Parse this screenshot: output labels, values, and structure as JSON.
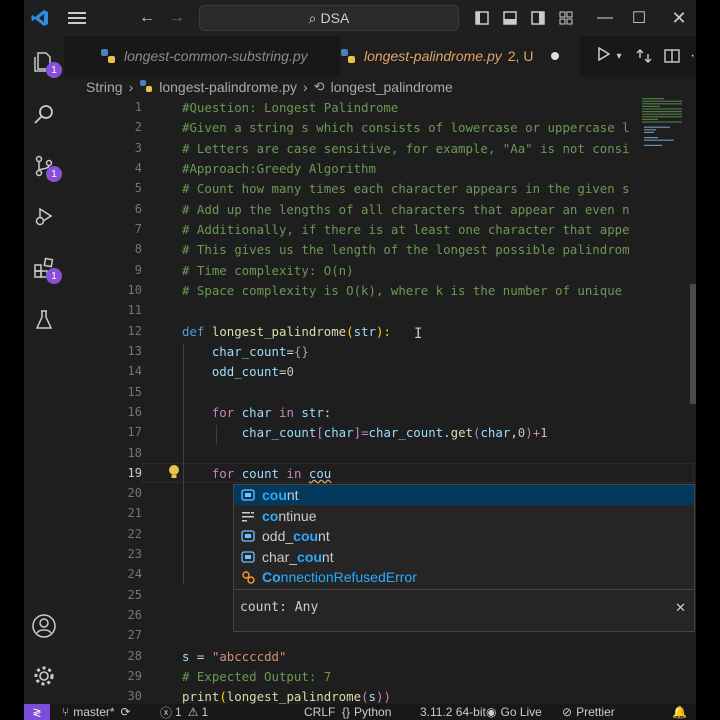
{
  "titlebar": {
    "search_text": "DSA"
  },
  "activity": {
    "explorer_badge": "1",
    "scm_badge": "1",
    "extensions_badge": "1"
  },
  "tabs": [
    {
      "label": "longest-common-substring.py"
    },
    {
      "label": "longest-palindrome.py",
      "status": "2, U"
    }
  ],
  "breadcrumb": {
    "folder": "String",
    "file": "longest-palindrome.py",
    "symbol": "longest_palindrome"
  },
  "editor": {
    "line_numbers": [
      "1",
      "2",
      "3",
      "4",
      "5",
      "6",
      "7",
      "8",
      "9",
      "10",
      "11",
      "12",
      "13",
      "14",
      "15",
      "16",
      "17",
      "18",
      "19",
      "20",
      "21",
      "22",
      "23",
      "24",
      "25",
      "26",
      "27",
      "28",
      "29",
      "30"
    ],
    "comments": [
      "#Question: Longest Palindrome",
      "#Given a string s which consists of lowercase or uppercase l",
      "# Letters are case sensitive, for example, \"Aa\" is not consi",
      "#Approach:Greedy Algorithm",
      "# Count how many times each character appears in the given s",
      "# Add up the lengths of all characters that appear an even n",
      "# Additionally, if there is at least one character that appe",
      "# This gives us the length of the longest possible palindrom",
      "# Time complexity: O(n)",
      "# Space complexity is O(k), where k is the number of unique "
    ],
    "l12": {
      "def": "def",
      "name": "longest_palindrome",
      "open": "(",
      "param": "str",
      "close": "):"
    },
    "l13": {
      "var": "char_count",
      "eq": "=",
      "val": "{}"
    },
    "l14": {
      "var": "odd_count",
      "eq": "=",
      "val": "0"
    },
    "l16": {
      "for": "for",
      "var": "char",
      "in": "in",
      "iter": "str",
      "colon": ":"
    },
    "l17": {
      "a": "char_count",
      "b": "[",
      "c": "char",
      "d": "]=",
      "e": "char_count",
      "f": ".",
      "g": "get",
      "h": "(",
      "i": "char",
      "j": ",",
      "k": "0",
      "l": ")+",
      "m": "1"
    },
    "l19": {
      "for": "for",
      "var": "count",
      "in": "in",
      "typed": "cou"
    },
    "l28": {
      "var": "s",
      "eq": " = ",
      "val": "\"abccccdd\""
    },
    "l29": "# Expected Output: 7",
    "l30": {
      "fn": "print",
      "open": "(",
      "name": "longest_palindrome",
      "open2": "(",
      "arg": "s",
      "close": "))"
    }
  },
  "suggest": {
    "items": [
      {
        "pre": "",
        "match": "cou",
        "post": "nt",
        "icon": "variable-icon"
      },
      {
        "pre": "",
        "match": "co",
        "post": "ntinue",
        "matchb": "",
        "icon": "keyword-icon",
        "full": "continue"
      },
      {
        "pre": "odd_",
        "match": "cou",
        "post": "nt",
        "icon": "variable-icon"
      },
      {
        "pre": "char_",
        "match": "cou",
        "post": "nt",
        "icon": "variable-icon"
      },
      {
        "pre": "",
        "match": "Co",
        "post": "nnectionRefusedError",
        "icon": "class-icon"
      }
    ],
    "detail": "count: Any"
  },
  "statusbar": {
    "branch": "master*",
    "errors": "1",
    "warnings": "1",
    "eol": "CRLF",
    "language": "Python",
    "version": "3.11.2 64-bit",
    "golive": "Go Live",
    "prettier": "Prettier"
  }
}
